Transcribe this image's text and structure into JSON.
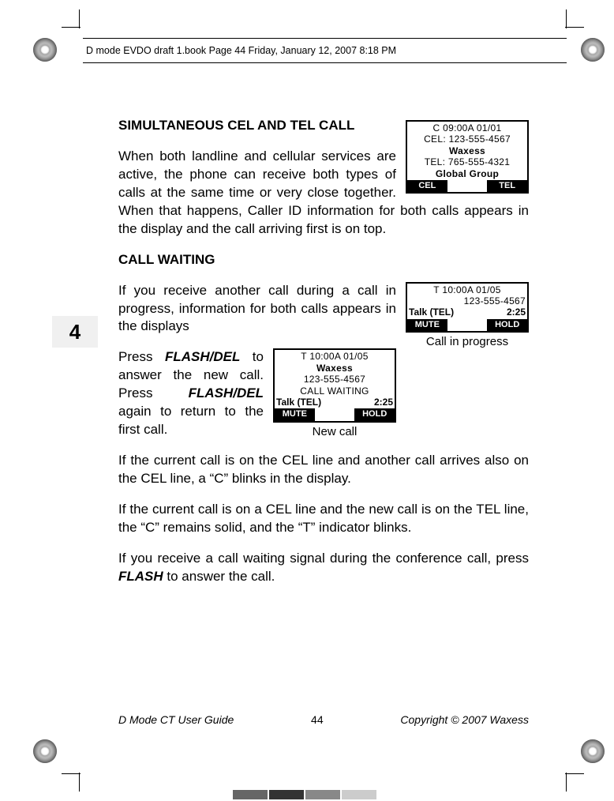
{
  "header": {
    "text": "D mode EVDO draft 1.book  Page 44  Friday, January 12, 2007  8:18 PM"
  },
  "chapter": {
    "number": "4"
  },
  "section1": {
    "title": "SIMULTANEOUS CEL AND TEL CALL",
    "para": "When both landline and cellular services are active, the phone can receive both types of calls at the same time or very close together. When that happens, Caller ID information for both calls appears in the display and the call arriving first is on top."
  },
  "lcd1": {
    "r1": "C  09:00A 01/01",
    "r2": "CEL: 123-555-4567",
    "r3": "Waxess",
    "r4": "TEL: 765-555-4321",
    "r5": "Global Group",
    "skL": "CEL",
    "skR": "TEL"
  },
  "section2": {
    "title": "CALL WAITING",
    "p1": "If you receive another call during a call in progress, information for both calls appears in the displays",
    "p2a": "Press ",
    "k1": "FLASH/DEL",
    "p2b": " to answer the new call. Press ",
    "k2": "FLASH/DEL",
    "p2c": " again to return to the first call.",
    "p3": "If the current call is on the CEL line and another call arrives also on the CEL line, a “C” blinks in the display.",
    "p4": "If the current call is on a CEL line and the new call is on the TEL line, the “C” remains solid, and the “T” indicator blinks.",
    "p5a": "If you receive a call waiting signal during the conference call, press ",
    "k3": "FLASH",
    "p5b": " to answer the call."
  },
  "lcd2": {
    "r1": "T  10:00A 01/05",
    "r2": "",
    "r3": "123-555-4567",
    "talkL": "Talk (TEL)",
    "talkR": "2:25",
    "skL": "MUTE",
    "skR": "HOLD",
    "caption": "Call in progress"
  },
  "lcd3": {
    "r1": "T  10:00A 01/05",
    "r2": "Waxess",
    "r3": "123-555-4567",
    "r4": "CALL WAITING",
    "talkL": "Talk (TEL)",
    "talkR": "2:25",
    "skL": "MUTE",
    "skR": "HOLD",
    "caption": "New call"
  },
  "footer": {
    "left": "D Mode CT User Guide",
    "page": "44",
    "right": "Copyright © 2007 Waxess"
  }
}
